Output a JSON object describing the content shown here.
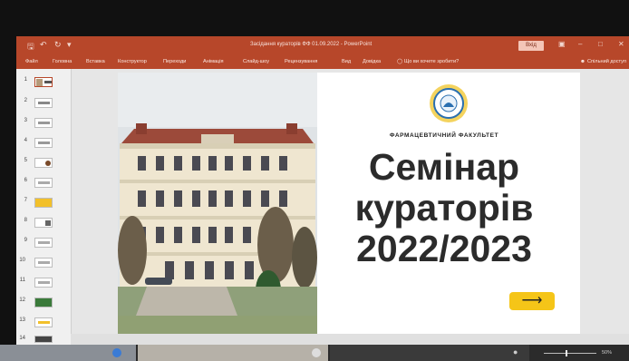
{
  "window": {
    "doc_title": "Засідання кураторів ФФ 01.09.2022 - PowerPoint",
    "login_label": "Вхід"
  },
  "quick_access": {
    "save_icon": "save-icon",
    "undo_icon": "undo-icon",
    "redo_icon": "redo-icon",
    "customize_icon": "customize-icon"
  },
  "ribbon": {
    "tabs": [
      "Файл",
      "Головна",
      "Вставка",
      "Конструктор",
      "Переходи",
      "Анімація",
      "Слайд-шоу",
      "Рецензування",
      "Вид",
      "Довідка"
    ],
    "tell_me": "Що ви хочете зробити?",
    "share": "Спільний доступ"
  },
  "thumbnails": {
    "numbers": [
      "1",
      "2",
      "3",
      "4",
      "5",
      "6",
      "7",
      "8",
      "9",
      "10",
      "11",
      "12",
      "13",
      "14"
    ],
    "active_index": 1
  },
  "slide": {
    "faculty": "ФАРМАЦЕВТИЧНИЙ ФАКУЛЬТЕТ",
    "title_line1": "Семінар",
    "title_line2": "кураторів",
    "title_line3": "2022/2023",
    "arrow": "⟶"
  },
  "status": {
    "zoom": "50%"
  },
  "colors": {
    "accent": "#b7472a",
    "button_yellow": "#f5c518"
  }
}
